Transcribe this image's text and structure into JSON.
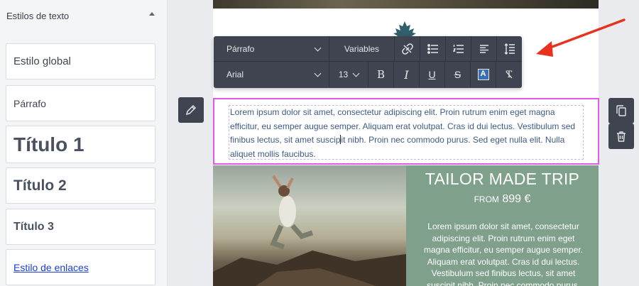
{
  "left_panel": {
    "title": "Estilos de texto",
    "styles": [
      {
        "label": "Estilo global"
      },
      {
        "label": "Párrafo"
      },
      {
        "label": "Título 1"
      },
      {
        "label": "Título 2"
      },
      {
        "label": "Título 3"
      },
      {
        "label": "Estilo de enlaces"
      }
    ]
  },
  "toolbar": {
    "paragraph_select": "Párrafo",
    "variables_label": "Variables",
    "font_select": "Arial",
    "font_size": "13",
    "bold": "B",
    "italic": "I",
    "underline": "U",
    "strikethrough": "S",
    "text_color": "A",
    "clear_format": "T"
  },
  "text_block": {
    "before_caret": "Lorem ipsum dolor sit amet, consectetur adipiscing elit. Proin rutrum enim eget magna efficitur, eu semper augue semper. Aliquam erat volutpat. Cras id dui lectus. Vestibulum sed finibus lectus, sit amet suscip",
    "after_caret": "it nibh. Proin nec commodo purus. Sed eget nulla elit. Nulla aliquet mollis faucibus."
  },
  "promo": {
    "title": "TAILOR MADE TRIP",
    "from": "FROM",
    "price": "899 €",
    "body": "Lorem ipsum dolor sit amet, consectetur adipiscing elit. Proin rutrum enim eget magna efficitur, eu semper augue semper. Aliquam erat volutpat. Cras id dui lectus. Vestibulum sed finibus lectus, sit amet suscipit nibh. Proin nec commodo purus."
  },
  "colors": {
    "toolbar_bg": "#3f4450",
    "selection_border": "#e05ae6",
    "promo_bg": "#7fa08a",
    "link": "#1a3ed6",
    "arrow": "#e8321f",
    "body_text": "#3e5a83"
  },
  "icons": {
    "collapse": "chevron-up-icon",
    "pencil": "pencil-icon",
    "copy": "copy-icon",
    "trash": "trash-icon",
    "maple": "maple-leaf-icon",
    "arrow": "red-arrow-icon"
  }
}
